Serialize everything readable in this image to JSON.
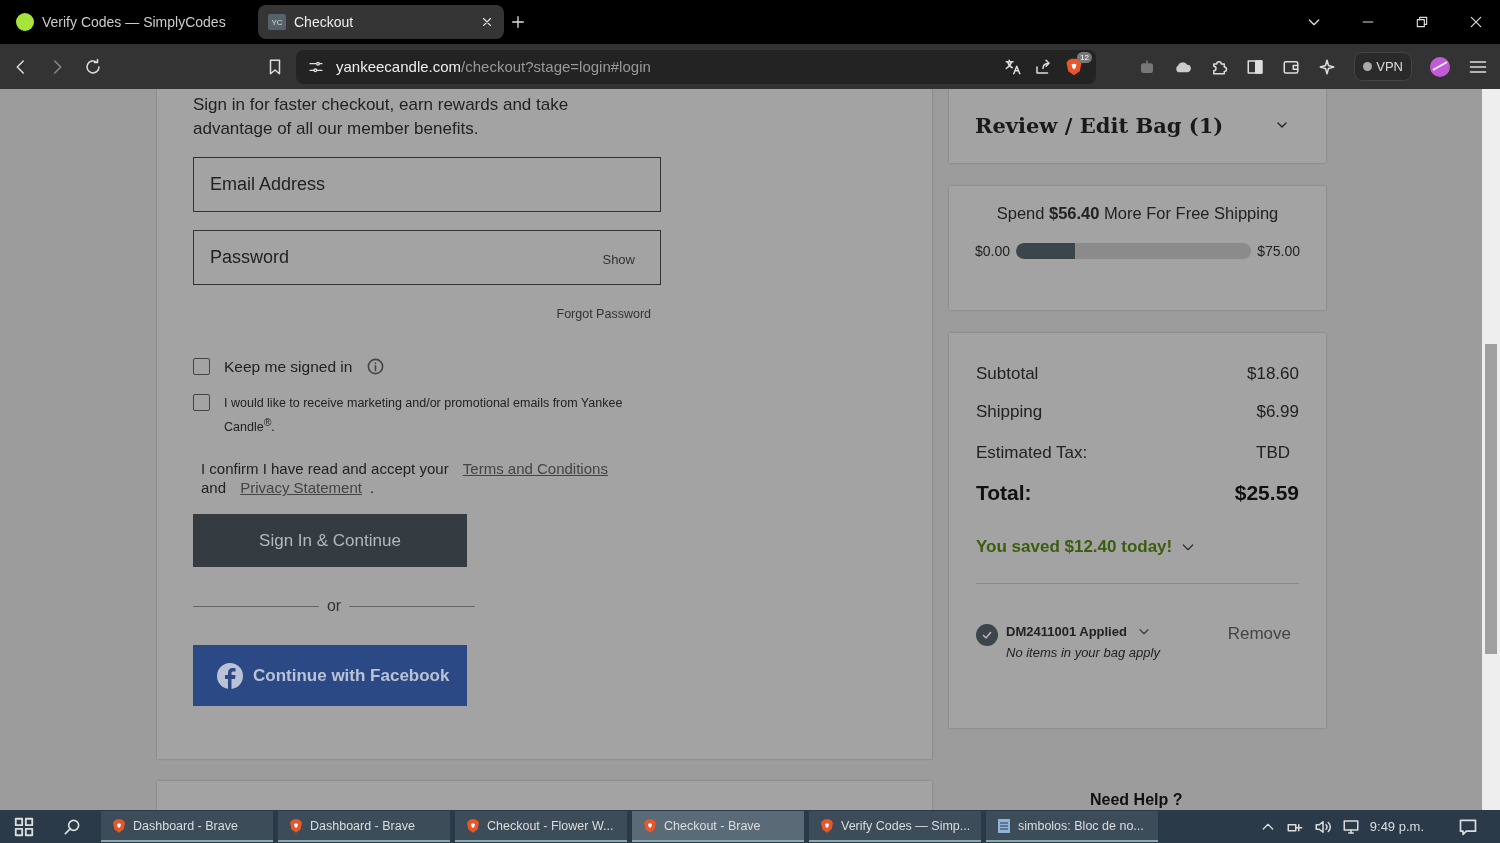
{
  "browser": {
    "tabs": [
      {
        "title": "Verify Codes — SimplyCodes",
        "selected": false,
        "kind": "simplycodes"
      },
      {
        "title": "Checkout",
        "selected": true,
        "kind": "yc",
        "favicon_text": "YC"
      }
    ],
    "url": {
      "domain": "yankeecandle.com",
      "path": "/checkout?stage=login#login"
    },
    "shield_count": "12",
    "vpn": "VPN"
  },
  "login": {
    "intro": [
      "Sign in for faster checkout, earn rewards and take",
      "advantage of all our member benefits."
    ],
    "fields": [
      {
        "placeholder": "Email Address"
      },
      {
        "placeholder": "Password",
        "toggle": "Show"
      }
    ],
    "forgot": "Forgot Password",
    "checkboxes": [
      {
        "label": "Keep me signed in",
        "checked": false,
        "info": true
      },
      {
        "label": "I would like to receive marketing and/or promotional emails from Yankee Candle$^{®}$.",
        "checked": false,
        "info": false
      }
    ],
    "consent": {
      "text": "I confirm I have read and accept your",
      "terms": "Terms and Conditions",
      "and": "and",
      "privacy": "Privacy Statement",
      "end": "."
    },
    "sign_in": "Sign In & Continue",
    "or": "or",
    "facebook": "Continue with Facebook"
  },
  "summary": {
    "bag_title": "Review / Edit Bag (1)",
    "shipping": {
      "message": "Spend **$56.40** More For Free Shipping",
      "min": "$0.00",
      "max": "$75.00",
      "level": 0.25
    },
    "rows": [
      {
        "label": "Subtotal",
        "value": "$18.60"
      },
      {
        "label": "Shipping",
        "value": "$6.99"
      },
      {
        "label": "Estimated Tax:",
        "value": "TBD"
      }
    ],
    "total": {
      "label": "Total:",
      "value": "$25.59"
    },
    "saved": "You saved $12.40 today!",
    "coupon": {
      "applied": true,
      "code": "DM2411001 Applied",
      "note": "No items in your bag apply",
      "remove": "Remove"
    }
  },
  "need_help": "Need Help ?",
  "taskbar": {
    "items": [
      {
        "title": "Dashboard - Brave",
        "kind": "brave",
        "selected": false
      },
      {
        "title": "Dashboard - Brave",
        "kind": "brave",
        "selected": false
      },
      {
        "title": "Checkout - Flower W...",
        "kind": "brave",
        "selected": false
      },
      {
        "title": "Checkout - Brave",
        "kind": "brave",
        "selected": true
      },
      {
        "title": "Verify Codes — Simp...",
        "kind": "brave",
        "selected": false
      },
      {
        "title": "simbolos: Bloc de no...",
        "kind": "notepad",
        "selected": false
      }
    ],
    "time": "9:49 p.m."
  }
}
